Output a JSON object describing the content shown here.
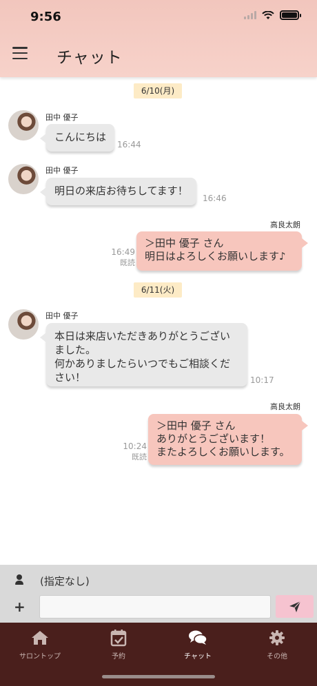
{
  "status": {
    "time": "9:56"
  },
  "header": {
    "title": "チャット",
    "menu_icon": "hamburger-menu-icon"
  },
  "messages": {
    "date1": "6/10(月)",
    "date2": "6/11(火)",
    "m1": {
      "sender": "田中 優子",
      "text": "こんにちは",
      "time": "16:44"
    },
    "m2": {
      "sender": "田中 優子",
      "text": "明日の来店お待ちしてます！",
      "time": "16:46"
    },
    "m3": {
      "sender": "高良太朗",
      "line1": "＞田中 優子 さん",
      "line2": "明日はよろしくお願いします♪",
      "time": "16:49",
      "read": "既読"
    },
    "m4": {
      "sender": "田中 優子",
      "line1": "本日は来店いただきありがとうござい",
      "line2": "ました。",
      "line3": "何かありましたらいつでもご相談くだ",
      "line4": "さい！",
      "time": "10:17"
    },
    "m5": {
      "sender": "高良太朗",
      "line1": "＞田中 優子 さん",
      "line2": "ありがとうございます！",
      "line3": "またよろしくお願いします。",
      "time": "10:24",
      "read": "既読"
    }
  },
  "input": {
    "recipient": "(指定なし)",
    "plus": "+",
    "placeholder": ""
  },
  "nav": {
    "home": "サロントップ",
    "booking": "予約",
    "chat": "チャット",
    "other": "その他"
  },
  "colors": {
    "header": "#f2c6bd",
    "incoming": "#e9e9e9",
    "outgoing": "#f7c6bd",
    "nav_bg": "#4a1f1c",
    "send": "#f6c3d0"
  }
}
